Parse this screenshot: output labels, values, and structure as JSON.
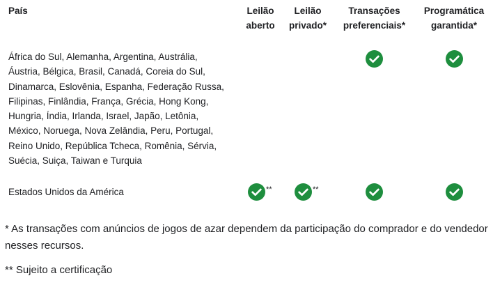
{
  "table": {
    "headers": {
      "country": "País",
      "open_auction": [
        "Leilão",
        "aberto"
      ],
      "private_auction": [
        "Leilão",
        "privado*"
      ],
      "preferred_deals": [
        "Transações",
        "preferenciais*"
      ],
      "programmatic_guaranteed": [
        "Programática",
        "garantida*"
      ]
    },
    "rows": [
      {
        "country_lines": [
          "África do Sul, Alemanha, Argentina, Austrália,",
          "Áustria, Bélgica, Brasil, Canadá, Coreia do Sul,",
          "Dinamarca, Eslovênia, Espanha, Federação Russa,",
          "Filipinas, Finlândia, França, Grécia, Hong Kong,",
          "Hungria, Índia, Irlanda, Israel, Japão, Letônia,",
          "México, Noruega, Nova Zelândia, Peru, Portugal,",
          "Reino Unido, República Tcheca, Romênia, Sérvia,",
          "Suécia, Suiça, Taiwan e Turquia"
        ],
        "open_auction": false,
        "private_auction": false,
        "preferred_deals": true,
        "programmatic_guaranteed": true
      },
      {
        "country": "Estados Unidos da América",
        "open_auction": true,
        "open_auction_mark": "**",
        "private_auction": true,
        "private_auction_mark": "**",
        "preferred_deals": true,
        "programmatic_guaranteed": true
      }
    ]
  },
  "notes": {
    "note_1": "* As transações com anúncios de jogos de azar dependem da participação do comprador e do vendedor nesses recursos.",
    "note_2": "** Sujeito a certificação"
  },
  "icons": {
    "check": "check-circle-icon"
  },
  "colors": {
    "check": "#1e8e3e",
    "text": "#202124"
  }
}
